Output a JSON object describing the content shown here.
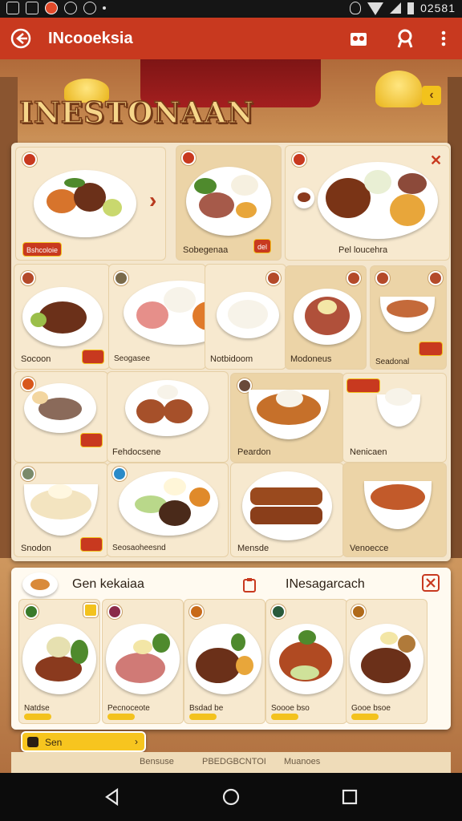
{
  "status_bar": {
    "time": "02581"
  },
  "app_bar": {
    "title": "INcooeksia"
  },
  "banner": {
    "title": "INESTONAAN"
  },
  "board": {
    "featured": [
      {
        "label": "Bshcoloie"
      },
      {
        "label": "Sobegenaa",
        "badge": "del"
      },
      {
        "label": "Pel loucehra"
      }
    ],
    "row2": [
      {
        "label": "Socoon"
      },
      {
        "label": "Seogasee"
      },
      {
        "label": "Notbidoom"
      },
      {
        "label": "Modoneus"
      },
      {
        "label": "Seadonal"
      }
    ],
    "row3": [
      {
        "label": "Fehdocsene"
      },
      {
        "label": "Peardon"
      },
      {
        "label": "Nenicaen"
      }
    ],
    "row4": [
      {
        "label": "Snodon"
      },
      {
        "label": "Seosaoheesnd"
      },
      {
        "label": "Mensde"
      },
      {
        "label": "Venoecce"
      }
    ]
  },
  "panel": {
    "left_title": "Gen kekaiaa",
    "right_title": "INesagarcach",
    "cards": [
      {
        "label": "Natdse"
      },
      {
        "label": "Pecnoceote"
      },
      {
        "label": "Bsdad be"
      },
      {
        "label": "Soooe bso"
      },
      {
        "label": "Gooe bsoe"
      }
    ]
  },
  "chip": {
    "label": "Sen"
  },
  "bottom_tabs": [
    "Bensuse",
    "PBEDGBCNTOI",
    "Muanoes"
  ],
  "colors": {
    "primary": "#c8391f",
    "accent": "#f3c21e",
    "board": "#f4e6cd"
  }
}
